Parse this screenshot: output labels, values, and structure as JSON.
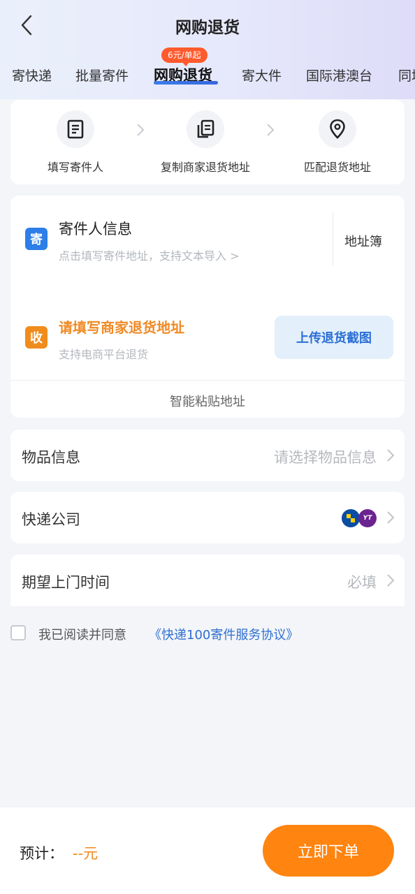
{
  "header": {
    "title": "网购退货",
    "back_icon": "chevron-left-icon"
  },
  "tabs": [
    {
      "label": "寄快递",
      "active": false
    },
    {
      "label": "批量寄件",
      "active": false
    },
    {
      "label": "网购退货",
      "active": true
    },
    {
      "label": "寄大件",
      "active": false
    },
    {
      "label": "国际港澳台",
      "active": false
    },
    {
      "label": "同城",
      "active": false
    }
  ],
  "promo_badge": "6元/单起",
  "steps": [
    {
      "label": "填写寄件人",
      "icon": "document-icon"
    },
    {
      "label": "复制商家退货地址",
      "icon": "copy-icon"
    },
    {
      "label": "匹配退货地址",
      "icon": "location-pin-icon"
    }
  ],
  "sender": {
    "icon_text": "寄",
    "title": "寄件人信息",
    "hint": "点击填写寄件地址，支持文本导入 >",
    "address_book": "地址簿"
  },
  "receiver": {
    "icon_text": "收",
    "title": "请填写商家退货地址",
    "subtitle": "支持电商平台退货",
    "upload_button": "上传退货截图"
  },
  "smart_paste": "智能粘贴地址",
  "goods": {
    "label": "物品信息",
    "value": "请选择物品信息"
  },
  "courier": {
    "label": "快递公司",
    "logo_b_text": "YT"
  },
  "pickup_time": {
    "label": "期望上门时间",
    "value": "必填"
  },
  "agreement": {
    "text": "我已阅读并同意",
    "link": "《快递100寄件服务协议》",
    "checked": false
  },
  "footer": {
    "estimate_label": "预计：",
    "estimate_value": "--元",
    "order_button": "立即下单"
  },
  "colors": {
    "accent_blue": "#2d7ee8",
    "accent_orange": "#ff8410",
    "promo_red": "#ff5a2c"
  }
}
